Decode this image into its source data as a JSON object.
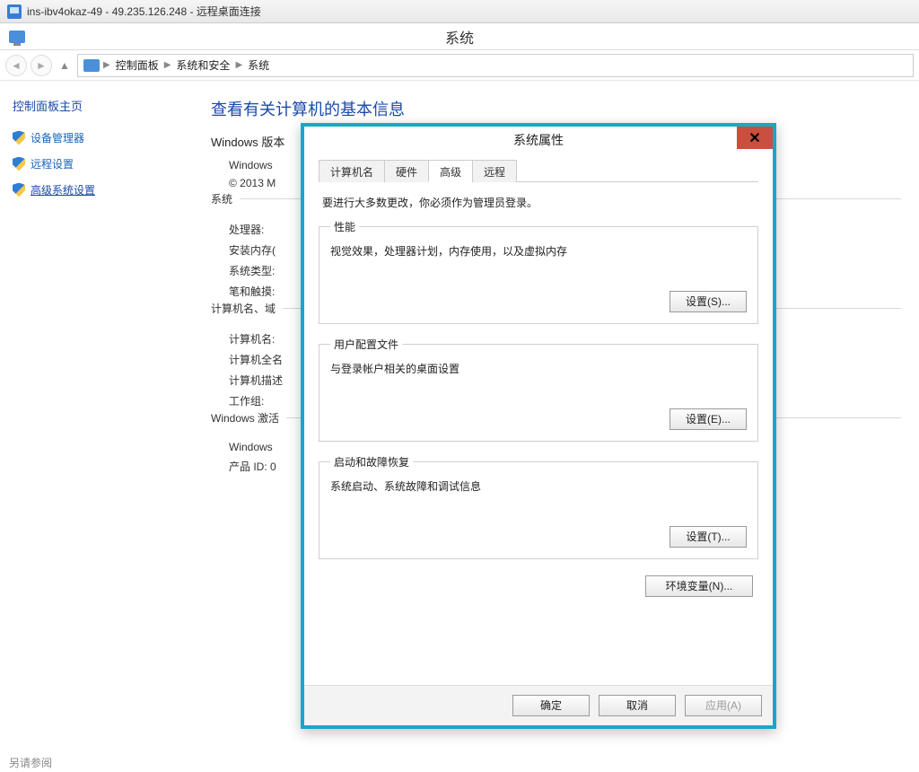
{
  "rdp": {
    "title": "ins-ibv4okaz-49 - 49.235.126.248 - 远程桌面连接"
  },
  "app_header": {
    "center_title": "系统"
  },
  "breadcrumb": {
    "items": [
      "控制面板",
      "系统和安全",
      "系统"
    ]
  },
  "left_panel": {
    "heading": "控制面板主页",
    "links": {
      "device_manager": "设备管理器",
      "remote_settings": "远程设置",
      "advanced_settings": "高级系统设置"
    }
  },
  "system_page": {
    "title": "查看有关计算机的基本信息",
    "windows_edition_label": "Windows 版本",
    "windows_line": "Windows",
    "copyright_line": "© 2013 M",
    "system_group_label": "系统",
    "rows": {
      "processor": "处理器:",
      "ram": "安装内存(",
      "system_type": "系统类型:",
      "pen_touch": "笔和触摸:"
    },
    "computer_group_label": "计算机名、域",
    "computer_rows": {
      "name": "计算机名:",
      "full_name": "计算机全名",
      "description": "计算机描述",
      "workgroup": "工作组:"
    },
    "activation_label": "Windows 激活",
    "activation_rows": {
      "windows": "Windows",
      "product_id": "产品 ID: 0"
    },
    "bottom_text": "另请参阅"
  },
  "dialog": {
    "title": "系统属性",
    "close_glyph": "✕",
    "tabs": {
      "computer_name": "计算机名",
      "hardware": "硬件",
      "advanced": "高级",
      "remote": "远程"
    },
    "note": "要进行大多数更改，你必须作为管理员登录。",
    "groups": {
      "performance": {
        "legend": "性能",
        "desc": "视觉效果，处理器计划，内存使用，以及虚拟内存",
        "button": "设置(S)..."
      },
      "profiles": {
        "legend": "用户配置文件",
        "desc": "与登录帐户相关的桌面设置",
        "button": "设置(E)..."
      },
      "startup": {
        "legend": "启动和故障恢复",
        "desc": "系统启动、系统故障和调试信息",
        "button": "设置(T)..."
      }
    },
    "env_button": "环境变量(N)...",
    "footer": {
      "ok": "确定",
      "cancel": "取消",
      "apply": "应用(A)"
    }
  }
}
